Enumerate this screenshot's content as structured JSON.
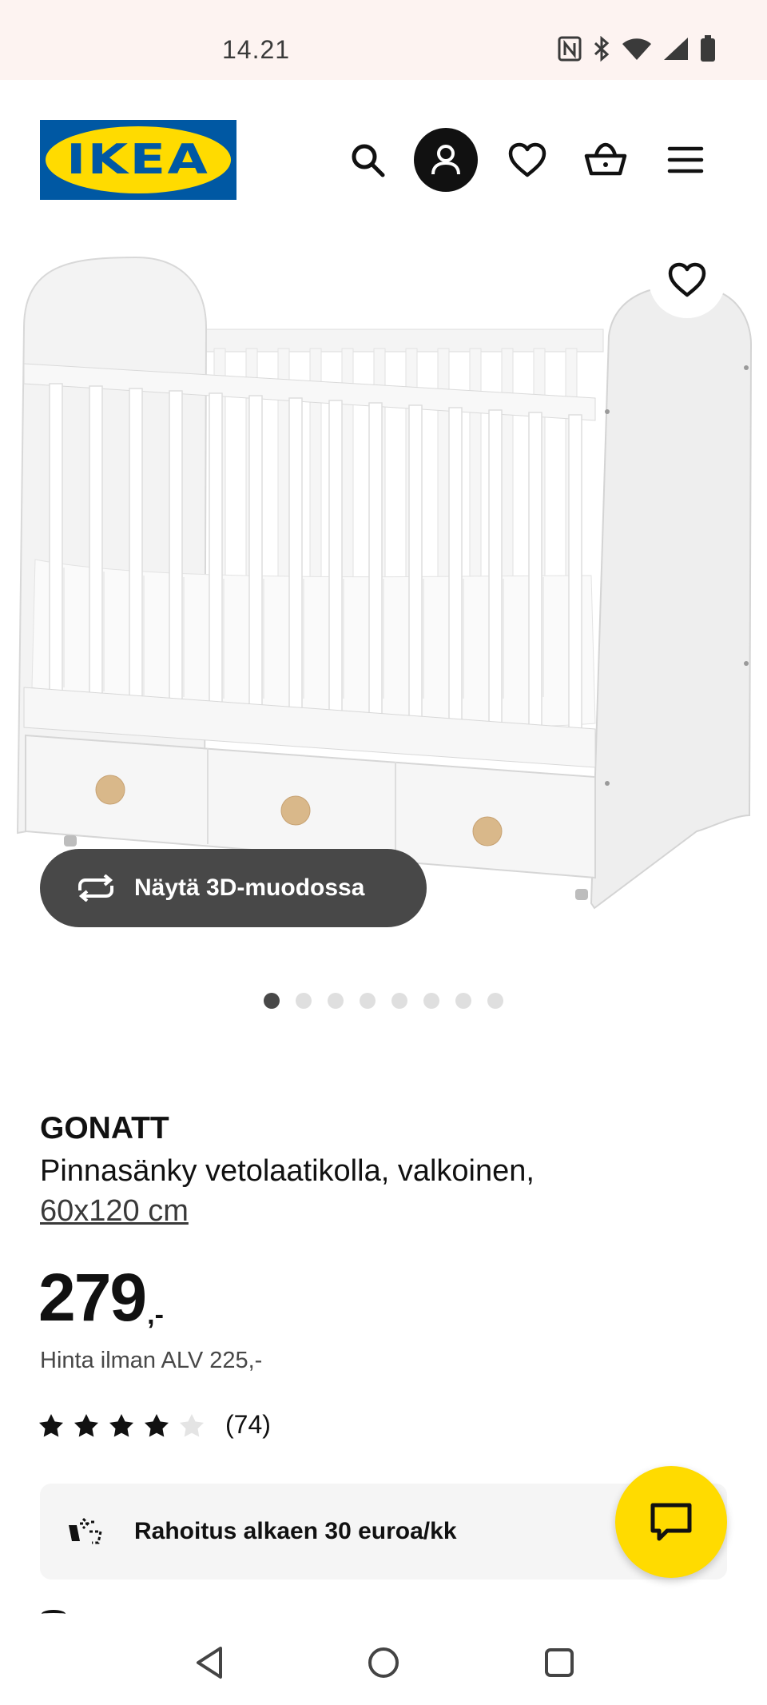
{
  "status_bar": {
    "time": "14.21",
    "icons": [
      "nfc-icon",
      "bluetooth-icon",
      "wifi-icon",
      "signal-icon",
      "battery-icon"
    ]
  },
  "header": {
    "logo_text": "IKEA",
    "icons": [
      "search-icon",
      "profile-icon",
      "heart-icon",
      "basket-icon",
      "menu-icon"
    ]
  },
  "gallery": {
    "view_3d_label": "Näytä 3D-muodossa",
    "image_count": 8,
    "active_index": 0
  },
  "product": {
    "name": "GONATT",
    "description": "Pinnasänky vetolaatikolla, valkoinen,",
    "size": "60x120 cm",
    "price": "279",
    "price_suffix": ",-",
    "price_ex_vat": "Hinta ilman ALV 225,-",
    "rating": 4,
    "rating_max": 5,
    "review_count": "(74)"
  },
  "financing": {
    "label": "Rahoitus alkaen 30 euroa/kk"
  },
  "colors": {
    "ikea_blue": "#0058a3",
    "ikea_yellow": "#ffdb00",
    "dark_button": "#484848"
  }
}
